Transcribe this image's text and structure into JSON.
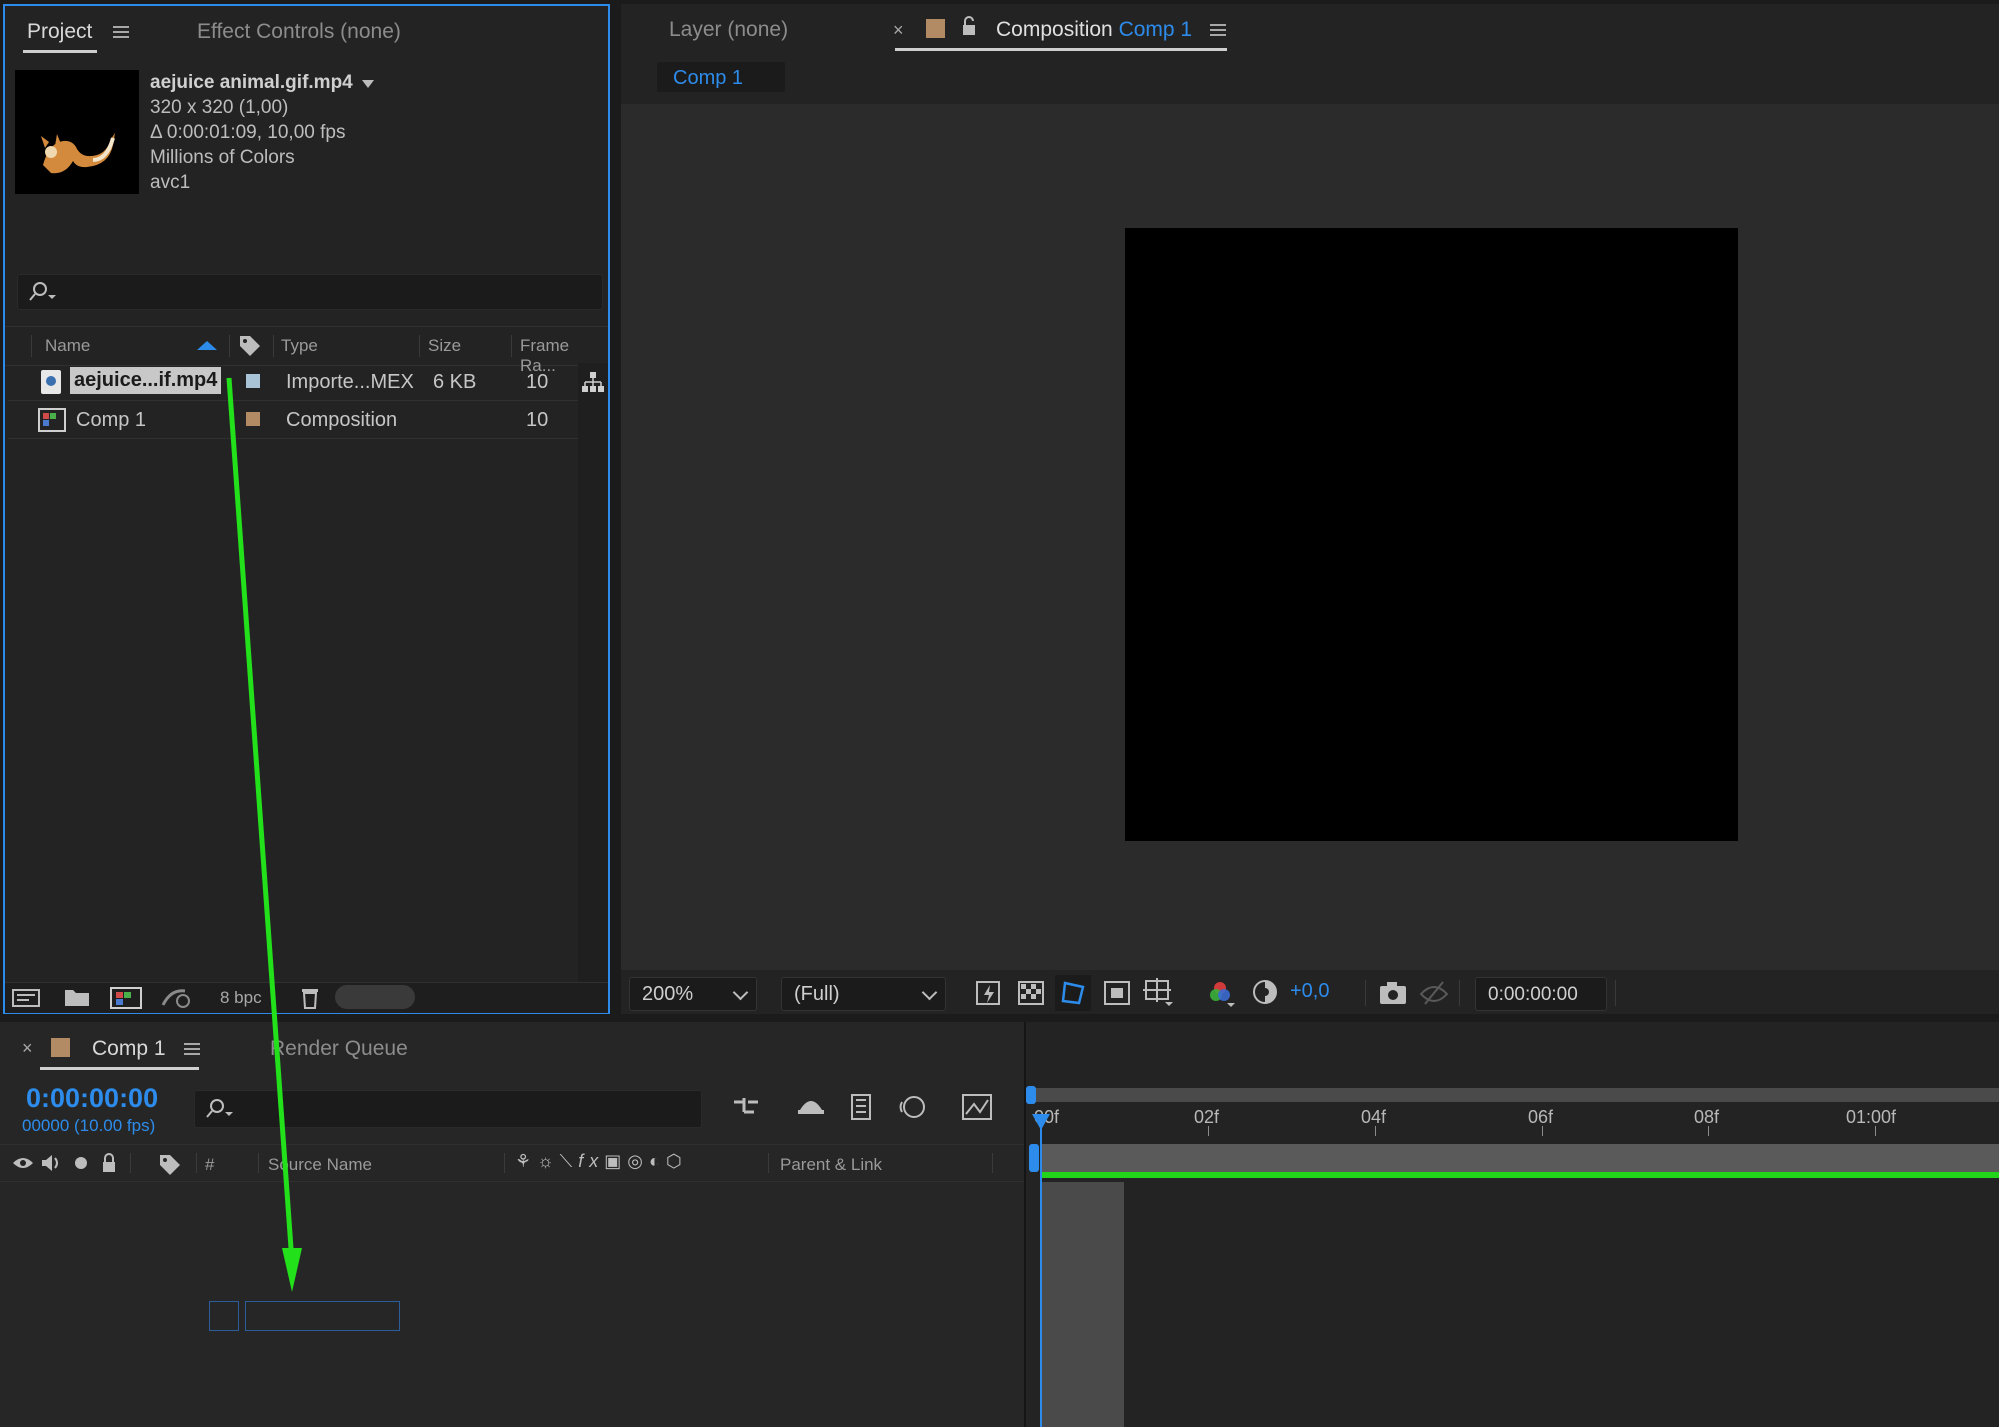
{
  "project": {
    "tab_label": "Project",
    "effect_tab_label": "Effect Controls (none)",
    "item_name": "aejuice animal.gif.mp4",
    "info_lines": [
      "320 x 320 (1,00)",
      "Δ 0:00:01:09, 10,00 fps",
      "Millions of Colors",
      "avc1"
    ],
    "search_placeholder": "",
    "columns": [
      "Name",
      "Type",
      "Size",
      "Frame Ra..."
    ],
    "rows": [
      {
        "name": "aejuice...if.mp4",
        "type": "Importe...MEX",
        "size": "6 KB",
        "fps": "10",
        "label_color": "#a9c4d6"
      },
      {
        "name": "Comp 1",
        "type": "Composition",
        "size": "",
        "fps": "10",
        "label_color": "#b28a63"
      }
    ],
    "bpc_label": "8 bpc"
  },
  "viewer": {
    "layer_tab": "Layer (none)",
    "comp_tab_prefix": "Composition",
    "comp_tab_name": "Comp 1",
    "breadcrumb": "Comp 1",
    "zoom": "200%",
    "resolution": "(Full)",
    "exposure": "+0,0",
    "timecode": "0:00:00:00"
  },
  "timeline": {
    "tab_label": "Comp 1",
    "render_queue_label": "Render Queue",
    "current_time": "0:00:00:00",
    "frame_info": "00000 (10.00 fps)",
    "col_number": "#",
    "col_source": "Source Name",
    "col_parent": "Parent & Link",
    "ruler_labels": [
      "00f",
      "02f",
      "04f",
      "06f",
      "08f",
      "01:00f"
    ]
  },
  "colors": {
    "accent": "#2d8ceb",
    "drag_arrow": "#22e01a",
    "comp_label": "#b28a63"
  }
}
